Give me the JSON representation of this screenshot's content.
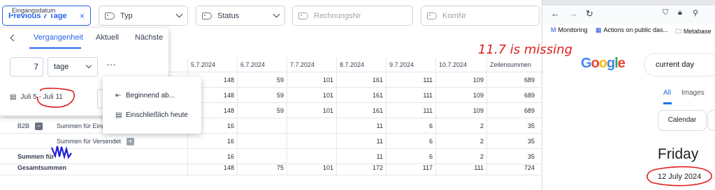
{
  "filters": {
    "date": {
      "label": "Eingangsdatum",
      "value": "Previous 7 Tage",
      "clear": "×"
    },
    "typ": {
      "label": "Typ"
    },
    "status": {
      "label": "Status"
    },
    "rechnung": {
      "label": "RechnungsNr"
    },
    "kom": {
      "label": "KomNr"
    }
  },
  "popover": {
    "tabs": [
      "Vergangenheit",
      "Aktuell",
      "Nächste"
    ],
    "amount": "7",
    "unit": "tage",
    "more": "···",
    "range": "Juli 5 - Juli 11",
    "menu": [
      "Beginnend ab...",
      "Einschließlich heute"
    ]
  },
  "table": {
    "columns": [
      "5.7.2024",
      "6.7.2024",
      "7.7.2024",
      "8.7.2024",
      "9.7.2024",
      "10.7.2024",
      "Zeilensummen"
    ],
    "rows": [
      {
        "label": "",
        "values": [
          "148",
          "59",
          "101",
          "161",
          "111",
          "109",
          "689"
        ]
      },
      {
        "label": "",
        "values": [
          "148",
          "59",
          "101",
          "161",
          "111",
          "109",
          "689"
        ]
      },
      {
        "label": "",
        "values": [
          "148",
          "59",
          "101",
          "161",
          "111",
          "109",
          "689"
        ]
      },
      {
        "label": "B2B",
        "sub": "Summen für Eing",
        "values": [
          "16",
          "",
          "",
          "11",
          "6",
          "2",
          "35"
        ]
      },
      {
        "label": "",
        "sub": "Summen für Versendet",
        "values": [
          "16",
          "",
          "",
          "11",
          "6",
          "2",
          "35"
        ]
      },
      {
        "label": "Summen für",
        "values": [
          "16",
          "",
          "",
          "11",
          "6",
          "2",
          "35"
        ]
      },
      {
        "label": "Gesamtsummen",
        "values": [
          "148",
          "75",
          "101",
          "172",
          "117",
          "111",
          "724"
        ]
      }
    ],
    "b2b_toggle": "−",
    "versendet_toggle": "+"
  },
  "browser": {
    "bookmarks": [
      "Monitoring",
      "Actions on public das...",
      "Metabase"
    ],
    "search_query": "current day",
    "tabs": [
      "All",
      "Images"
    ],
    "chip": "Calendar",
    "day": "Friday",
    "date": "12 July 2024"
  },
  "annotation": {
    "text": "11.7 is missing",
    "color": "#e11d1d"
  },
  "colors": {
    "accent": "#2563eb",
    "annotation": "#e11d1d",
    "scribble": "#1d1dd6"
  }
}
